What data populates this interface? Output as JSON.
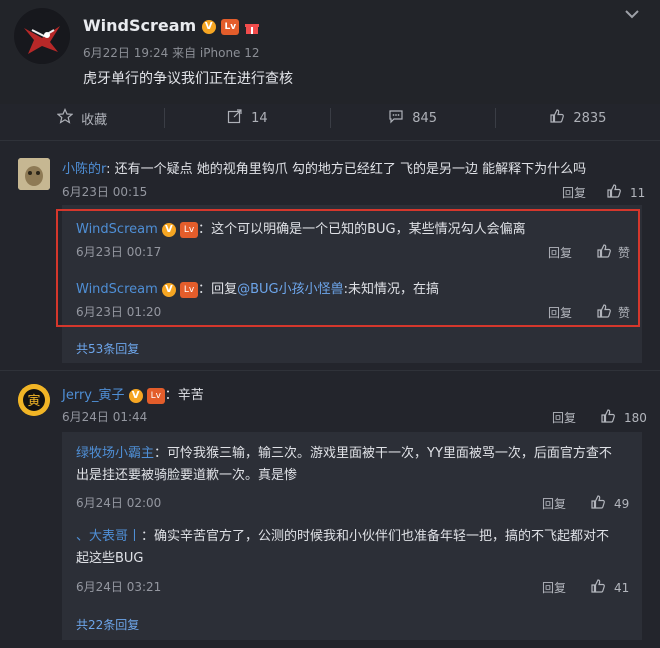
{
  "post": {
    "author": "WindScream",
    "badge_v": "V",
    "badge_level": "Lv",
    "meta": "6月22日 19:24 来自 iPhone 12",
    "text": "虎牙单行的争议我们正在进行查核"
  },
  "actions": {
    "collect": "收藏",
    "repost": "14",
    "comments": "845",
    "likes": "2835"
  },
  "comments": [
    {
      "user": "小陈的r",
      "text": "还有一个疑点 她的视角里钩爪 勾的地方已经红了 飞的是另一边 能解释下为什么吗",
      "time": "6月23日 00:15",
      "reply_label": "回复",
      "likes": "11",
      "replies": [
        {
          "user": "WindScream",
          "text": "这个可以明确是一个已知的BUG，某些情况勾人会偏离",
          "time": "6月23日 00:17",
          "reply_label": "回复",
          "like_label": "赞"
        },
        {
          "user": "WindScream",
          "prefix": "回复",
          "mention": "@BUG小孩小怪兽",
          "text": ":未知情况，在搞",
          "time": "6月23日 01:20",
          "reply_label": "回复",
          "like_label": "赞"
        }
      ],
      "more": "共53条回复"
    },
    {
      "user": "Jerry_寅子",
      "text": "辛苦",
      "time": "6月24日 01:44",
      "reply_label": "回复",
      "likes": "180",
      "replies": [
        {
          "user": "绿牧场小霸主",
          "text_line1": "可怜我猴三输，输三次。游戏里面被干一次，YY里面被骂一次，后面官方查不",
          "text_line2": "出是挂还要被骑脸要道歉一次。真是惨",
          "time": "6月24日 02:00",
          "reply_label": "回复",
          "likes": "49"
        },
        {
          "user": "、大表哥丨",
          "text_line1": "确实辛苦官方了，公测的时候我和小伙伴们也准备年轻一把，搞的不飞起都对不",
          "text_line2": "起这些BUG",
          "time": "6月24日 03:21",
          "reply_label": "回复",
          "likes": "41"
        }
      ],
      "more": "共22条回复"
    }
  ]
}
